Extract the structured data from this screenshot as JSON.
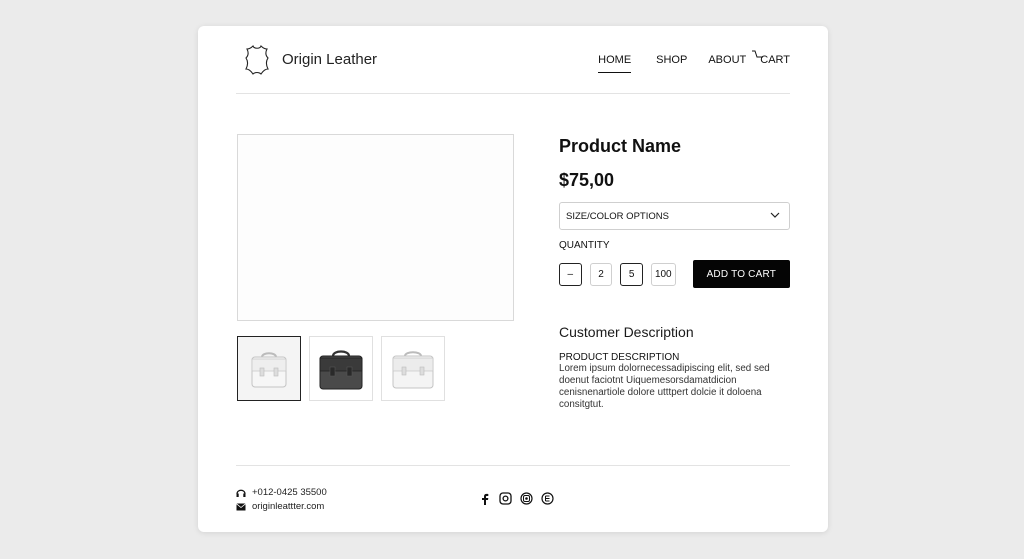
{
  "header": {
    "brand": "Origin Leather",
    "icon": "leather-hide-icon",
    "nav": {
      "home": "HOME",
      "shop": "SHOP",
      "about": "ABOUT",
      "cart": "CART"
    }
  },
  "product": {
    "name": "Product Name",
    "price": "$75,00",
    "select_value": "SIZE/COLOR OPTIONS",
    "quantity_label": "QUANTITY",
    "quantity_options": [
      "–",
      "2",
      "5",
      "100"
    ],
    "add_to_cart": "ADD TO CART",
    "thumbnails": [
      "white-bag",
      "dark-bag",
      "white-bag"
    ]
  },
  "description": {
    "title": "Customer Description",
    "subtitle": "PRODUCT DESCRIPTION",
    "body": "Lorem ipsum dolornecessadipiscing elit, sed sed doenut faciotnt Uiquemesorsdamatdicion cenisnenartiole dolore utttpert dolcie it doloena consitgtut."
  },
  "footer": {
    "phone": "+012-0425 35500",
    "email": "originleattter.com",
    "social": [
      "facebook-icon",
      "instagram-icon",
      "camera-icon",
      "pinterest-icon"
    ]
  },
  "colors": {
    "accent": "#050505",
    "border": "#cfcfcf",
    "background": "#ebebeb"
  }
}
